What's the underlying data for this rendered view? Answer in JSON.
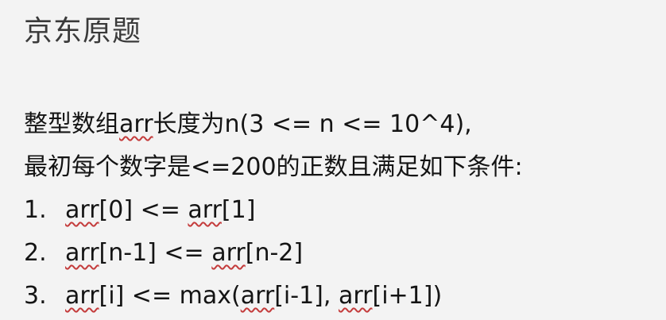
{
  "title": "京东原题",
  "intro": {
    "prefix": "整型数组",
    "arr": "arr",
    "suffix": "长度为n(3 <= n <= 10^4),"
  },
  "line2": "最初每个数字是<=200的正数且满足如下条件:",
  "conditions": [
    {
      "num": "1.",
      "parts": [
        "arr",
        "[0] <= ",
        "arr",
        "[1]"
      ]
    },
    {
      "num": "2.",
      "parts": [
        "arr",
        "[n-1] <= ",
        "arr",
        "[n-2]"
      ]
    },
    {
      "num": "3.",
      "parts": [
        "arr",
        "[i] <= max(",
        "arr",
        "[i-1], ",
        "arr",
        "[i+1])"
      ]
    }
  ]
}
